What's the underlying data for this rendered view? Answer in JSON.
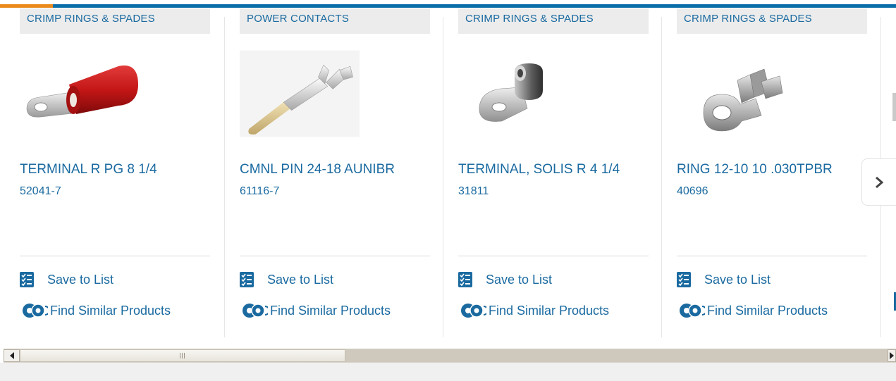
{
  "cards": [
    {
      "category": "CRIMP RINGS & SPADES",
      "title": "TERMINAL R PG 8 1/4",
      "part_number": "52041-7",
      "save_label": "Save to List",
      "find_label": "Find Similar Products",
      "image": "red-insulated-ring-terminal"
    },
    {
      "category": "POWER CONTACTS",
      "title": "CMNL PIN 24-18 AUNIBR",
      "part_number": "61116-7",
      "save_label": "Save to List",
      "find_label": "Find Similar Products",
      "image": "crimp-pin-contact"
    },
    {
      "category": "CRIMP RINGS & SPADES",
      "title": "TERMINAL, SOLIS R 4 1/4",
      "part_number": "31811",
      "save_label": "Save to List",
      "find_label": "Find Similar Products",
      "image": "solistrand-ring-terminal"
    },
    {
      "category": "CRIMP RINGS & SPADES",
      "title": "RING 12-10 10 .030TPBR",
      "part_number": "40696",
      "save_label": "Save to List",
      "find_label": "Find Similar Products",
      "image": "uninsulated-ring-terminal"
    }
  ],
  "icons": {
    "next": "chevron-right-icon",
    "save": "checklist-icon",
    "find": "gears-icon"
  },
  "colors": {
    "link": "#1a6aa0",
    "accent_orange": "#e98a1b",
    "accent_blue": "#0a6ea8",
    "category_bg": "#ececec"
  }
}
